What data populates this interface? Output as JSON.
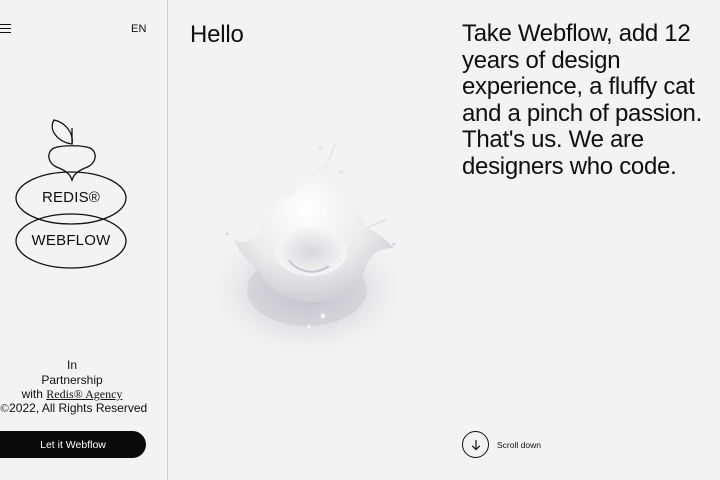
{
  "sidebar": {
    "language": "EN",
    "logo": {
      "top_label": "REDIS®",
      "bottom_label": "WEBFLOW"
    },
    "partnership": {
      "line1": "In",
      "line2": "Partnership",
      "line3_prefix": "with ",
      "agency_link": "Redis® Agency"
    },
    "copyright_symbol": "©",
    "copyright_text": "2022, All Rights Reserved",
    "cta_label": "Let it Webflow"
  },
  "main": {
    "greeting": "Hello",
    "intro": "Take Webflow, add 12 years of design experience, a fluffy cat and a pinch of passion. That's us. We are designers who code.",
    "scroll_label": "Scroll down"
  },
  "icons": {
    "menu": "hamburger-menu-icon",
    "scroll": "arrow-down-icon"
  },
  "colors": {
    "background": "#f3f3f3",
    "text": "#0f0f0f",
    "cta_background": "#0a0a0a",
    "cta_text": "#ffffff"
  }
}
